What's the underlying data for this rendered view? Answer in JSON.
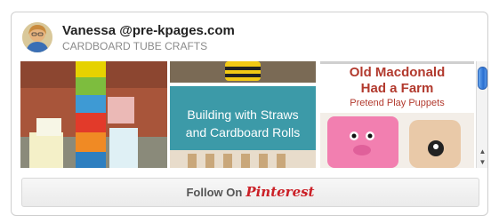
{
  "pinner": {
    "name": "Vanessa @pre-kpages.com",
    "board": "CARDBOARD TUBE CRAFTS"
  },
  "pins": {
    "pin2_caption": "Building with Straws and Cardboard Rolls",
    "pin3_title": "Old Macdonald Had a Farm",
    "pin3_subtitle": "Pretend Play Puppets"
  },
  "follow": {
    "label": "Follow On",
    "brand": "Pinterest"
  },
  "scroll": {
    "up_arrow": "▲",
    "down_arrow": "▼"
  },
  "colors": {
    "brand_red": "#cb2027",
    "caption_teal": "#3c9aa8",
    "scroll_thumb": "#2a6fd1"
  }
}
